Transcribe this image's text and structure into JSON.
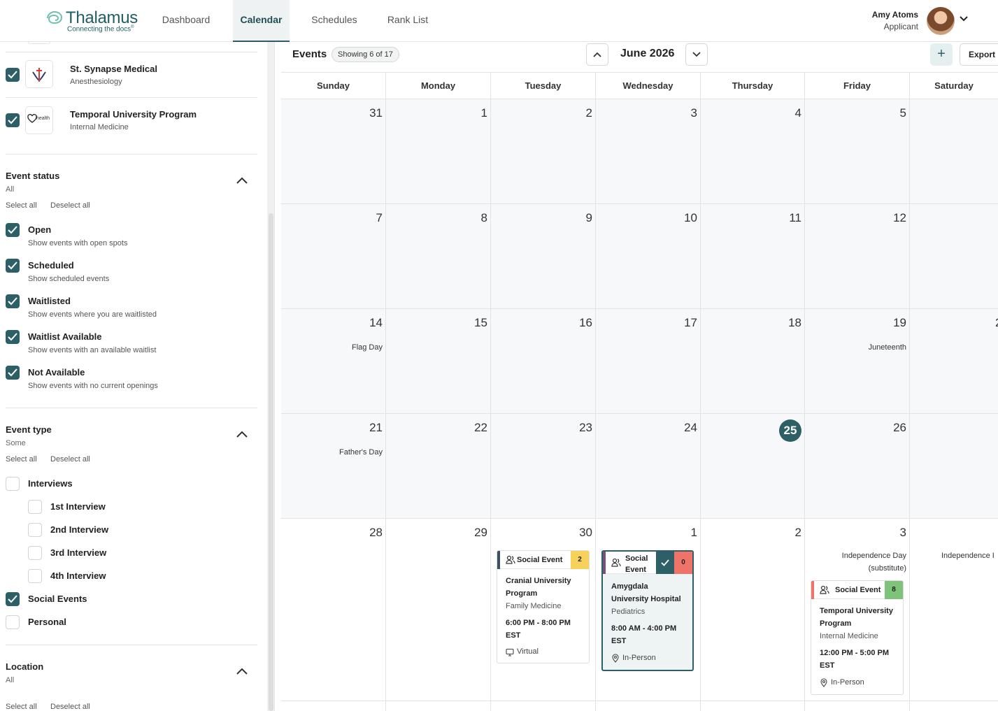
{
  "nav": {
    "logo_name": "Thalamus",
    "logo_tag": "Connecting the docs",
    "logo_tag_mark": "®",
    "links": [
      "Dashboard",
      "Calendar",
      "Schedules",
      "Rank List"
    ],
    "active": "Calendar",
    "user_name": "Amy Atoms",
    "user_role": "Applicant"
  },
  "sidebar": {
    "programs": [
      {
        "name": "St. Synapse Medical",
        "specialty": "Anesthesiology",
        "checked": true
      },
      {
        "name": "Temporal University Program",
        "specialty": "Internal Medicine",
        "checked": true,
        "logo_text": "health"
      }
    ],
    "event_status": {
      "title": "Event status",
      "summary": "All",
      "select_all": "Select all",
      "deselect_all": "Deselect all",
      "options": [
        {
          "label": "Open",
          "desc": "Show events with open spots",
          "checked": true
        },
        {
          "label": "Scheduled",
          "desc": "Show scheduled events",
          "checked": true
        },
        {
          "label": "Waitlisted",
          "desc": "Show events where you are waitlisted",
          "checked": true
        },
        {
          "label": "Waitlist Available",
          "desc": "Show events with an available waitlist",
          "checked": true
        },
        {
          "label": "Not Available",
          "desc": "Show events with no current openings",
          "checked": true
        }
      ]
    },
    "event_type": {
      "title": "Event type",
      "summary": "Some",
      "select_all": "Select all",
      "deselect_all": "Deselect all",
      "interviews": {
        "label": "Interviews",
        "checked": false
      },
      "sub_interviews": [
        {
          "label": "1st Interview",
          "checked": false
        },
        {
          "label": "2nd Interview",
          "checked": false
        },
        {
          "label": "3rd Interview",
          "checked": false
        },
        {
          "label": "4th Interview",
          "checked": false
        }
      ],
      "social": {
        "label": "Social Events",
        "checked": true
      },
      "personal": {
        "label": "Personal",
        "checked": false
      }
    },
    "location": {
      "title": "Location",
      "summary": "All",
      "select_all": "Select all",
      "deselect_all": "Deselect all"
    }
  },
  "calendar": {
    "title": "Events",
    "badge": "Showing 6 of 17",
    "month": "June 2026",
    "add_label": "+",
    "export_label": "Export",
    "weekdays": [
      "Sunday",
      "Monday",
      "Tuesday",
      "Wednesday",
      "Thursday",
      "Friday",
      "Saturday"
    ],
    "weeks": [
      [
        "31",
        "1",
        "2",
        "3",
        "4",
        "5",
        ""
      ],
      [
        "7",
        "8",
        "9",
        "10",
        "11",
        "12",
        ""
      ],
      [
        "14",
        "15",
        "16",
        "17",
        "18",
        "19",
        "2"
      ],
      [
        "21",
        "22",
        "23",
        "24",
        "25",
        "26",
        ""
      ],
      [
        "28",
        "29",
        "30",
        "1",
        "2",
        "3",
        ""
      ]
    ],
    "today": "25",
    "holidays": {
      "flag_day": "Flag Day",
      "juneteenth": "Juneteenth",
      "fathers_day": "Father's Day",
      "independence_sub_1": "Independence Day",
      "independence_sub_2": "(substitute)",
      "independence_sat": "Independence I"
    },
    "events": [
      {
        "type": "Social Event",
        "count": "2",
        "count_color": "#f7d25b",
        "bar_color": "#3b4f66",
        "program_l1": "Cranial University",
        "program_l2": "Program",
        "specialty": "Family Medicine",
        "time_l1": "6:00 PM - 8:00 PM",
        "time_l2": "EST",
        "location": "Virtual",
        "location_icon": "monitor-icon"
      },
      {
        "type_l1": "Social",
        "type_l2": "Event",
        "count": "0",
        "count_color": "#f0736a",
        "check_color": "#2d5f66",
        "bar_color": "#7a4f7a",
        "program_l1": "Amygdala",
        "program_l2": "University Hospital",
        "specialty": "Pediatrics",
        "time_l1": "8:00 AM - 4:00 PM",
        "time_l2": "EST",
        "location": "In-Person",
        "location_icon": "pin-icon"
      },
      {
        "type": "Social Event",
        "count": "8",
        "count_color": "#7dc47a",
        "bar_color": "#f0736a",
        "program_l1": "Temporal University",
        "program_l2": "Program",
        "specialty": "Internal Medicine",
        "time_l1": "12:00 PM - 5:00 PM",
        "time_l2": "EST",
        "location": "In-Person",
        "location_icon": "pin-icon"
      }
    ]
  }
}
